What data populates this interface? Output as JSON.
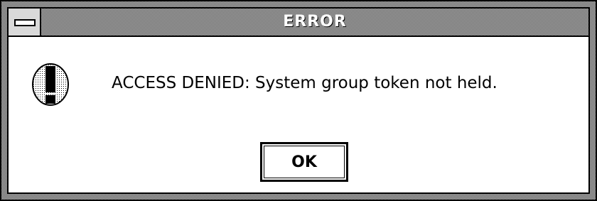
{
  "window": {
    "title": "ERROR",
    "system_menu_icon": "minus-icon"
  },
  "dialog": {
    "icon": "exclamation-icon",
    "message": "ACCESS DENIED: System group token not held.",
    "ok_label": "OK"
  },
  "colors": {
    "frame_dark": "#5c5c5c",
    "frame_light": "#b5b5b5",
    "background": "#ffffff",
    "text": "#000000"
  }
}
